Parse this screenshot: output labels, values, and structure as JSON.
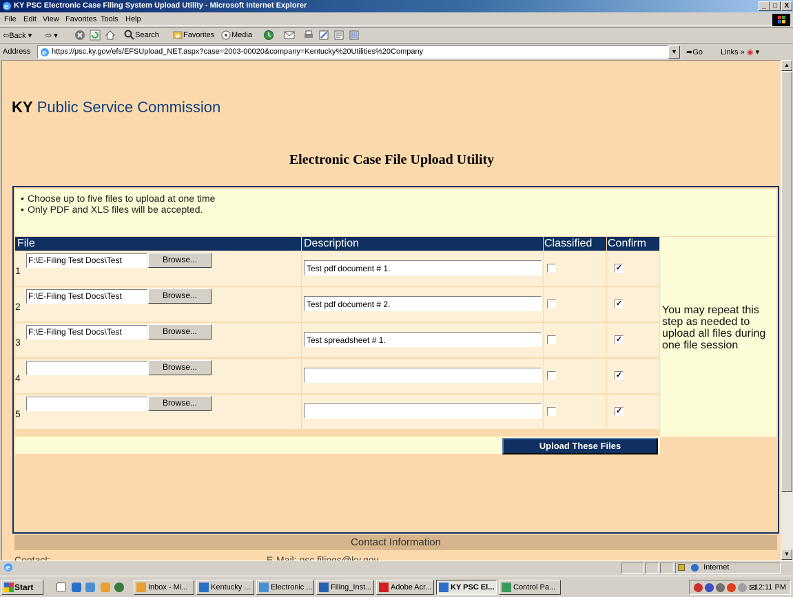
{
  "window": {
    "title": "KY PSC Electronic Case Filing System Upload Utility - Microsoft Internet Explorer",
    "min": "_",
    "max": "□",
    "close": "X"
  },
  "menu": [
    "File",
    "Edit",
    "View",
    "Favorites",
    "Tools",
    "Help"
  ],
  "toolbar": {
    "back": "Back",
    "search": "Search",
    "favorites": "Favorites",
    "media": "Media"
  },
  "address": {
    "label": "Address",
    "url": "https://psc.ky.gov/efs/EFSUpload_NET.aspx?case=2003-00020&company=Kentucky%20Utilities%20Company",
    "go": "Go",
    "links": "Links »"
  },
  "page": {
    "brand_prefix": "KY",
    "brand_name": "Public Service Commission",
    "heading": "Electronic Case File Upload Utility",
    "instructions": [
      "Choose up to five files to upload at one time",
      "Only PDF and XLS files will be accepted."
    ],
    "columns": {
      "file": "File",
      "description": "Description",
      "classified": "Classified",
      "confirm": "Confirm"
    },
    "browse_label": "Browse...",
    "rows": [
      {
        "num": "1",
        "file": "F:\\E-Filing Test Docs\\Test",
        "description": "Test pdf document # 1.",
        "classified": false,
        "confirm": true
      },
      {
        "num": "2",
        "file": "F:\\E-Filing Test Docs\\Test",
        "description": "Test pdf document # 2.",
        "classified": false,
        "confirm": true
      },
      {
        "num": "3",
        "file": "F:\\E-Filing Test Docs\\Test",
        "description": "Test spreadsheet # 1.",
        "classified": false,
        "confirm": true
      },
      {
        "num": "4",
        "file": "",
        "description": "",
        "classified": false,
        "confirm": true
      },
      {
        "num": "5",
        "file": "",
        "description": "",
        "classified": false,
        "confirm": true
      }
    ],
    "side_note": "You may repeat this step as needed to upload all files during one file session",
    "upload_button": "Upload These Files",
    "contact_header": "Contact Information",
    "contact_label": "Contact:",
    "contact_email": "E-Mail: psc.filings@ky.gov"
  },
  "status": {
    "zone": "Internet"
  },
  "taskbar": {
    "start": "Start",
    "buttons": [
      {
        "label": "Inbox - Mi...",
        "active": false,
        "color": "#e8a030"
      },
      {
        "label": "Kentucky ...",
        "active": false,
        "color": "#2a6fc9"
      },
      {
        "label": "Electronic ...",
        "active": false,
        "color": "#4a8fd0"
      },
      {
        "label": "Filing_Inst...",
        "active": false,
        "color": "#2a5fb0"
      },
      {
        "label": "Adobe Acr...",
        "active": false,
        "color": "#d02020"
      },
      {
        "label": "KY PSC El...",
        "active": true,
        "color": "#2a6fc9"
      },
      {
        "label": "Control Pa...",
        "active": false,
        "color": "#3a9a5a"
      }
    ],
    "clock": "12:11 PM"
  }
}
